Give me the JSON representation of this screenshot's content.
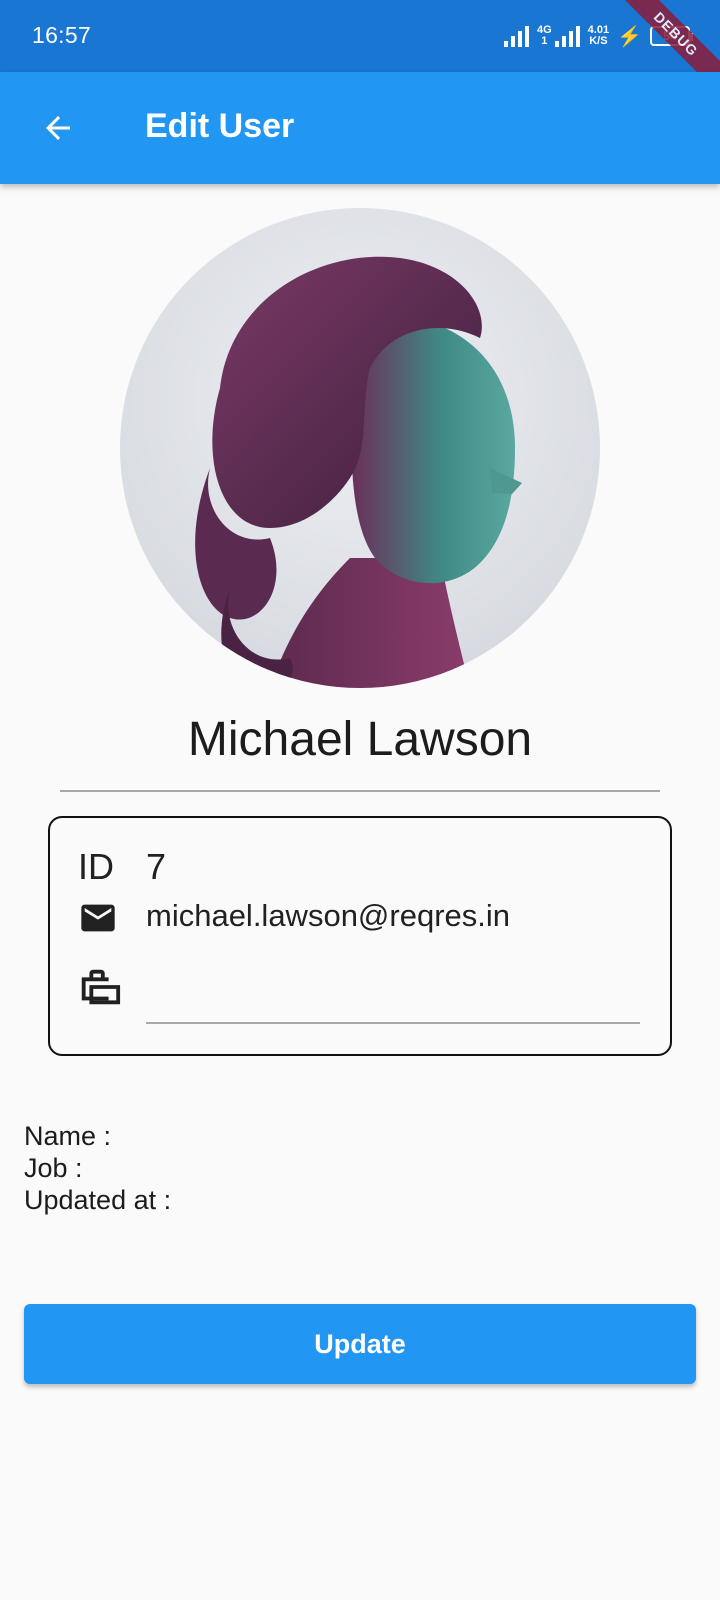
{
  "status_bar": {
    "time": "16:57",
    "network": "4G",
    "network_sub": "1",
    "speed_value": "4.01",
    "speed_unit": "K/S",
    "battery": "54",
    "debug_label": "DEBUG"
  },
  "app_bar": {
    "title": "Edit User",
    "back_icon": "arrow-back-icon",
    "color": "#2196f3"
  },
  "user": {
    "name": "Michael Lawson",
    "id_label": "ID",
    "id_value": "7",
    "email": "michael.lawson@reqres.in",
    "job_value": ""
  },
  "meta": {
    "name_label": "Name :",
    "job_label": "Job :",
    "updated_label": "Updated at :"
  },
  "actions": {
    "update_label": "Update"
  }
}
